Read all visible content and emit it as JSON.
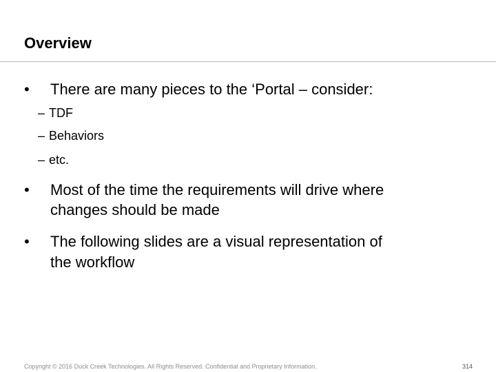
{
  "slide": {
    "title": "Overview",
    "bullets": [
      {
        "marker": "•",
        "lines": [
          "There are many pieces to the ‘Portal – consider:"
        ],
        "subitems": [
          {
            "marker": "–",
            "text": "TDF"
          },
          {
            "marker": "–",
            "text": "Behaviors"
          },
          {
            "marker": "–",
            "text": "etc."
          }
        ]
      },
      {
        "marker": "•",
        "lines": [
          "Most of the time the requirements will drive where",
          "changes should be made"
        ]
      },
      {
        "marker": "•",
        "lines": [
          "The following slides are a visual representation of",
          "the workflow"
        ]
      }
    ]
  },
  "footer": {
    "copyright": "Copyright © 2016 Duck Creek Technologies. All Rights Reserved. Confidential and Proprietary Information.",
    "page_number": "314"
  }
}
